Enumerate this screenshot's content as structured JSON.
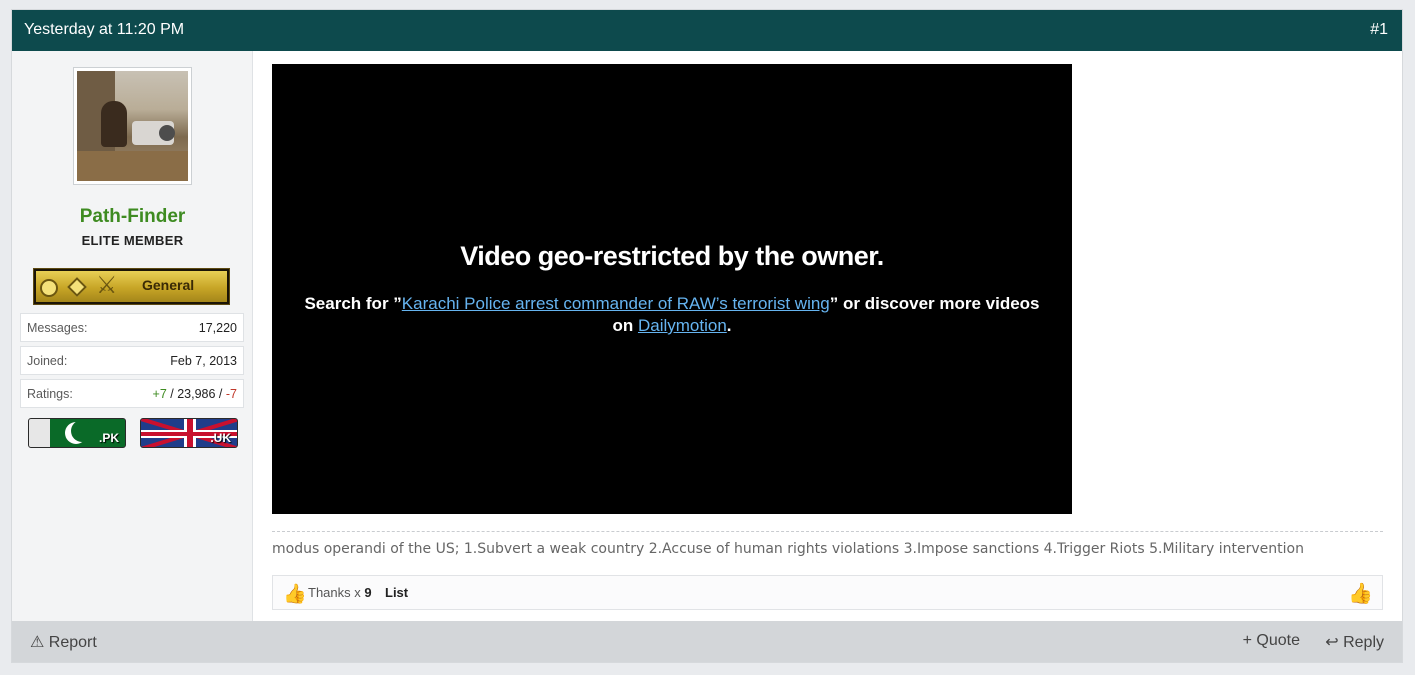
{
  "header": {
    "timestamp": "Yesterday at 11:20 PM",
    "post_number": "#1"
  },
  "user": {
    "name": "Path-Finder",
    "title": "ELITE MEMBER",
    "rank_label": "General",
    "stats": [
      {
        "label": "Messages:",
        "value": "17,220"
      },
      {
        "label": "Joined:",
        "value": "Feb 7, 2013"
      }
    ],
    "ratings": {
      "label": "Ratings:",
      "positive": "+7",
      "sep1": " / ",
      "neutral": "23,986",
      "sep2": " / ",
      "negative": "-7"
    },
    "flags": [
      {
        "code": ".PK"
      },
      {
        "code": ".UK"
      }
    ]
  },
  "video": {
    "title": "Video geo-restricted by the owner.",
    "msg_prefix": "Search for ”",
    "msg_link": "Karachi Police arrest commander of RAW’s terrorist wing",
    "msg_mid": "” or discover more videos on ",
    "msg_link2": "Dailymotion",
    "msg_suffix": "."
  },
  "message": "modus operandi of the US; 1.Subvert a weak country 2.Accuse of human rights violations 3.Impose sanctions 4.Trigger Riots 5.Military intervention",
  "likes": {
    "thanks_text": "Thanks x ",
    "count": "9",
    "list_label": "List"
  },
  "footer": {
    "report": "Report",
    "quote": "+ Quote",
    "reply": "Reply"
  },
  "icons": {
    "thumb": "thumbs-up-icon",
    "warning": "warning-icon",
    "reply": "reply-icon"
  }
}
